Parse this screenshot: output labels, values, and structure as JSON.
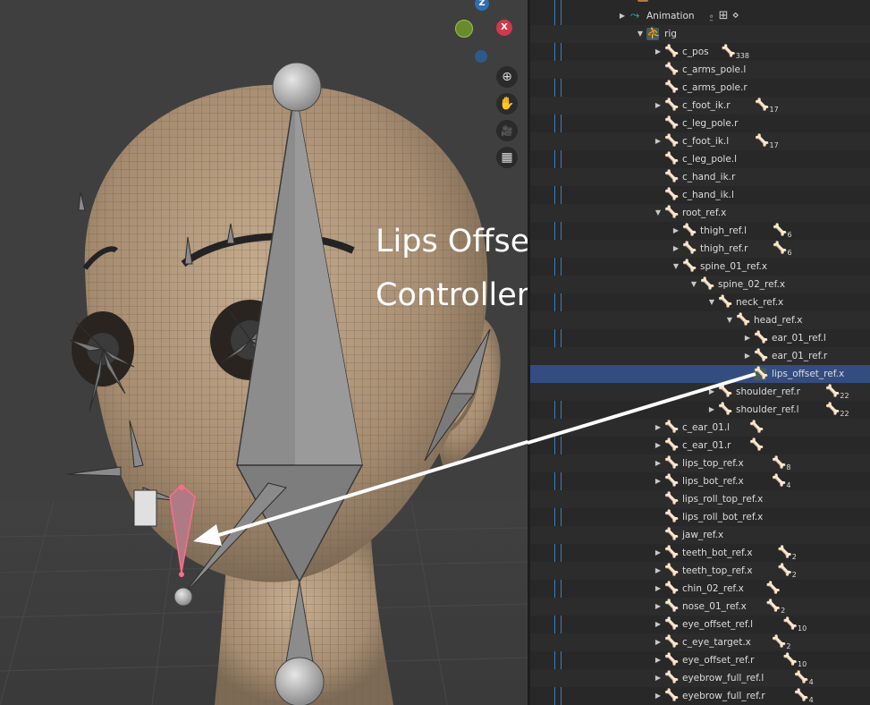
{
  "viewport": {
    "annotation_line1": "Lips Offset",
    "annotation_line2": "Controller",
    "gizmo": {
      "z_label": "Z",
      "x_label": "X"
    },
    "nav_buttons": [
      {
        "name": "zoom-icon",
        "glyph": "⊕"
      },
      {
        "name": "hand-icon",
        "glyph": "✋"
      },
      {
        "name": "camera-icon",
        "glyph": "🎥"
      },
      {
        "name": "grid-icon",
        "glyph": "▦"
      }
    ]
  },
  "outliner": {
    "top_label": "rig",
    "rows": [
      {
        "label": "Animation",
        "arrow": "▶",
        "icon": "⤳",
        "extra": "⍛ ⊞ ⋄",
        "extra_gray": true
      },
      {
        "label": "rig",
        "arrow": "▼",
        "icon": "⛹",
        "boxed": true
      },
      {
        "label": "c_pos",
        "arrow": "▶",
        "icon": "🦴",
        "extra_icon": "🦴",
        "count": "338"
      },
      {
        "label": "c_arms_pole.l",
        "arrow": "",
        "icon": "🦴"
      },
      {
        "label": "c_arms_pole.r",
        "arrow": "",
        "icon": "🦴"
      },
      {
        "label": "c_foot_ik.r",
        "arrow": "▶",
        "icon": "🦴",
        "extra_icon": "🦴",
        "count": "17"
      },
      {
        "label": "c_leg_pole.r",
        "arrow": "",
        "icon": "🦴"
      },
      {
        "label": "c_foot_ik.l",
        "arrow": "▶",
        "icon": "🦴",
        "extra_icon": "🦴",
        "count": "17"
      },
      {
        "label": "c_leg_pole.l",
        "arrow": "",
        "icon": "🦴"
      },
      {
        "label": "c_hand_ik.r",
        "arrow": "",
        "icon": "🦴"
      },
      {
        "label": "c_hand_ik.l",
        "arrow": "",
        "icon": "🦴"
      },
      {
        "label": "root_ref.x",
        "arrow": "▼",
        "icon": "🦴"
      },
      {
        "label": "thigh_ref.l",
        "arrow": "▶",
        "icon": "🦴",
        "extra_icon": "🦴",
        "count": "6"
      },
      {
        "label": "thigh_ref.r",
        "arrow": "▶",
        "icon": "🦴",
        "extra_icon": "🦴",
        "count": "6"
      },
      {
        "label": "spine_01_ref.x",
        "arrow": "▼",
        "icon": "🦴"
      },
      {
        "label": "spine_02_ref.x",
        "arrow": "▼",
        "icon": "🦴"
      },
      {
        "label": "neck_ref.x",
        "arrow": "▼",
        "icon": "🦴"
      },
      {
        "label": "head_ref.x",
        "arrow": "▼",
        "icon": "🦴"
      },
      {
        "label": "ear_01_ref.l",
        "arrow": "▶",
        "icon": "🦴"
      },
      {
        "label": "ear_01_ref.r",
        "arrow": "▶",
        "icon": "🦴"
      },
      {
        "label": "lips_offset_ref.x",
        "arrow": "",
        "icon": "🦴",
        "boxed": true,
        "selected": true
      },
      {
        "label": "shoulder_ref.r",
        "arrow": "▶",
        "icon": "🦴",
        "extra_icon": "🦴",
        "count": "22"
      },
      {
        "label": "shoulder_ref.l",
        "arrow": "▶",
        "icon": "🦴",
        "extra_icon": "🦴",
        "count": "22"
      },
      {
        "label": "c_ear_01.l",
        "arrow": "▶",
        "icon": "🦴",
        "extra_icon": "🦴"
      },
      {
        "label": "c_ear_01.r",
        "arrow": "▶",
        "icon": "🦴",
        "extra_icon": "🦴"
      },
      {
        "label": "lips_top_ref.x",
        "arrow": "▶",
        "icon": "🦴",
        "extra_icon": "🦴",
        "count": "8"
      },
      {
        "label": "lips_bot_ref.x",
        "arrow": "▶",
        "icon": "🦴",
        "extra_icon": "🦴",
        "count": "4"
      },
      {
        "label": "lips_roll_top_ref.x",
        "arrow": "",
        "icon": "🦴"
      },
      {
        "label": "lips_roll_bot_ref.x",
        "arrow": "",
        "icon": "🦴"
      },
      {
        "label": "jaw_ref.x",
        "arrow": "",
        "icon": "🦴"
      },
      {
        "label": "teeth_bot_ref.x",
        "arrow": "▶",
        "icon": "🦴",
        "extra_icon": "🦴",
        "count": "2"
      },
      {
        "label": "teeth_top_ref.x",
        "arrow": "▶",
        "icon": "🦴",
        "extra_icon": "🦴",
        "count": "2"
      },
      {
        "label": "chin_02_ref.x",
        "arrow": "▶",
        "icon": "🦴",
        "extra_icon": "🦴"
      },
      {
        "label": "nose_01_ref.x",
        "arrow": "▶",
        "icon": "🦴",
        "extra_icon": "🦴",
        "count": "2"
      },
      {
        "label": "eye_offset_ref.l",
        "arrow": "▶",
        "icon": "🦴",
        "extra_icon": "🦴",
        "count": "10"
      },
      {
        "label": "c_eye_target.x",
        "arrow": "▶",
        "icon": "🦴",
        "extra_icon": "🦴",
        "count": "2"
      },
      {
        "label": "eye_offset_ref.r",
        "arrow": "▶",
        "icon": "🦴",
        "extra_icon": "🦴",
        "count": "10"
      },
      {
        "label": "eyebrow_full_ref.l",
        "arrow": "▶",
        "icon": "🦴",
        "extra_icon": "🦴",
        "count": "4"
      },
      {
        "label": "eyebrow_full_ref.r",
        "arrow": "▶",
        "icon": "🦴",
        "extra_icon": "🦴",
        "count": "4"
      }
    ]
  }
}
